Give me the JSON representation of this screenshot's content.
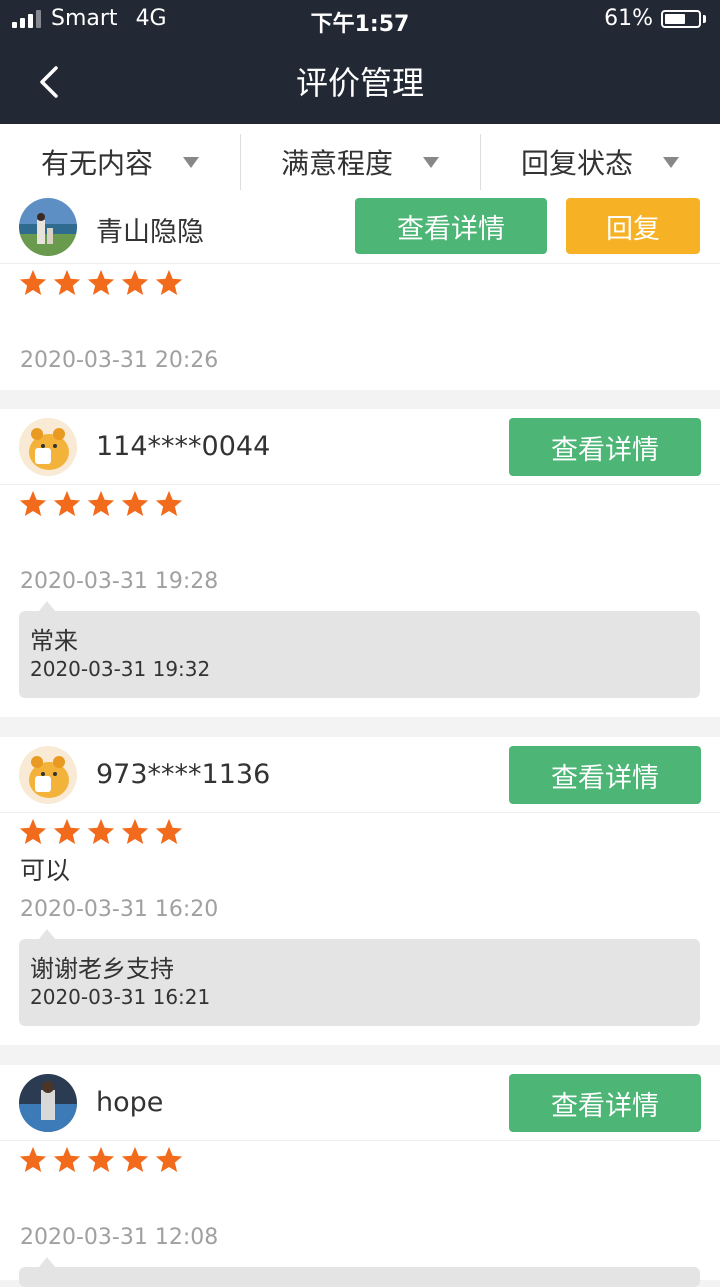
{
  "status_bar": {
    "carrier": "Smart",
    "network": "4G",
    "time": "下午1:57",
    "battery": "61%",
    "battery_level": 0.61
  },
  "nav": {
    "title": "评价管理"
  },
  "filters": [
    {
      "label": "有无内容"
    },
    {
      "label": "满意程度"
    },
    {
      "label": "回复状态"
    }
  ],
  "reviews": [
    {
      "user": "青山隐隐",
      "stars": 5,
      "content": "",
      "date": "2020-03-31 20:26",
      "detail_button": "查看详情",
      "reply_button": "回复"
    },
    {
      "user": "114****0044",
      "stars": 5,
      "content": "",
      "date": "2020-03-31 19:28",
      "detail_button": "查看详情",
      "reply": {
        "text": "常来",
        "date": "2020-03-31 19:32"
      }
    },
    {
      "user": "973****1136",
      "stars": 5,
      "content": "可以",
      "date": "2020-03-31 16:20",
      "detail_button": "查看详情",
      "reply": {
        "text": "谢谢老乡支持",
        "date": "2020-03-31 16:21"
      }
    },
    {
      "user": "hope",
      "stars": 5,
      "content": "",
      "date": "2020-03-31 12:08",
      "detail_button": "查看详情"
    }
  ],
  "colors": {
    "header": "#232934",
    "green_button": "#4db677",
    "orange_button": "#f6b224",
    "star": "#f26a1b"
  }
}
